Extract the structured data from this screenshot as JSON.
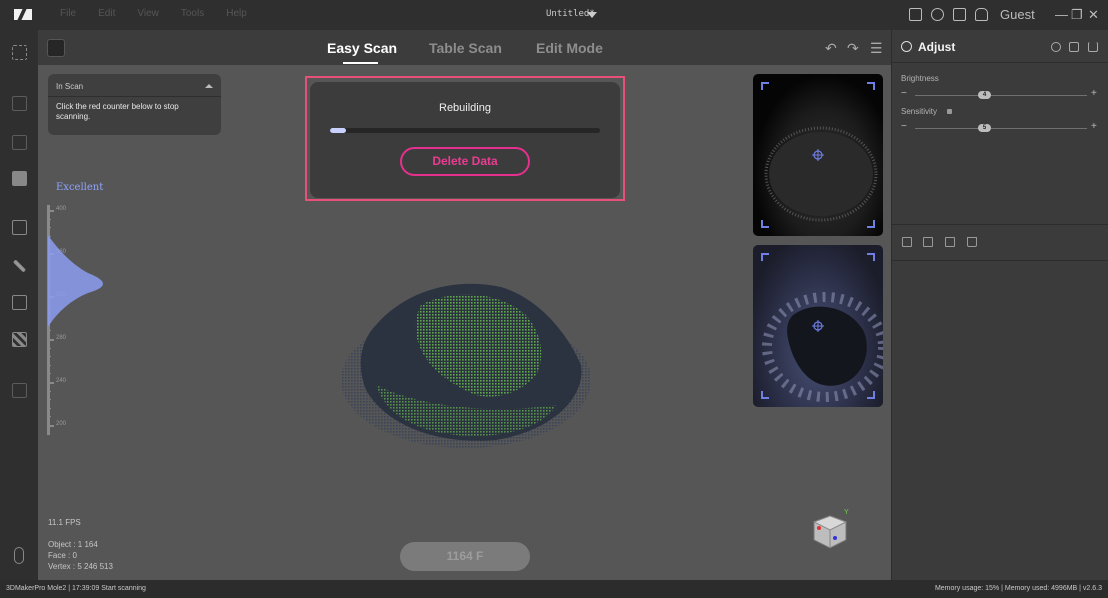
{
  "titlebar": {
    "menu": [
      "File",
      "Edit",
      "View",
      "Tools",
      "Help"
    ],
    "document_title": "Untitled*",
    "user": "Guest"
  },
  "tabs": [
    {
      "label": "Easy Scan",
      "active": true
    },
    {
      "label": "Table Scan",
      "active": false
    },
    {
      "label": "Edit Mode",
      "active": false
    }
  ],
  "scan_status": {
    "header": "In Scan",
    "message": "Click the red counter below to stop scanning."
  },
  "quality": {
    "label": "Excellent",
    "ticks": [
      "400",
      "360",
      "320",
      "280",
      "240",
      "200"
    ]
  },
  "stats": {
    "fps": "11.1 FPS",
    "object": "Object : 1 164",
    "face": "Face : 0",
    "vertex": "Vertex : 5 246 513"
  },
  "dialog": {
    "title": "Rebuilding",
    "progress": 0.06,
    "button": "Delete Data"
  },
  "counter": "1164 F",
  "adjust": {
    "title": "Adjust",
    "brightness": {
      "label": "Brightness",
      "value": "4",
      "fraction": 0.4
    },
    "sensitivity": {
      "label": "Sensitivity",
      "value": "5",
      "fraction": 0.4
    }
  },
  "statusbar": {
    "left": "3DMakerPro Mole2  |  17:39:09 Start scanning",
    "right": "Memory usage: 15% | Memory used: 4996MB | v2.6.3"
  },
  "colors": {
    "accent_pink": "#e4308e",
    "highlight_frame": "#e8507a",
    "quality_blue": "#8fa4ff",
    "scan_green": "#4a9a3c"
  }
}
